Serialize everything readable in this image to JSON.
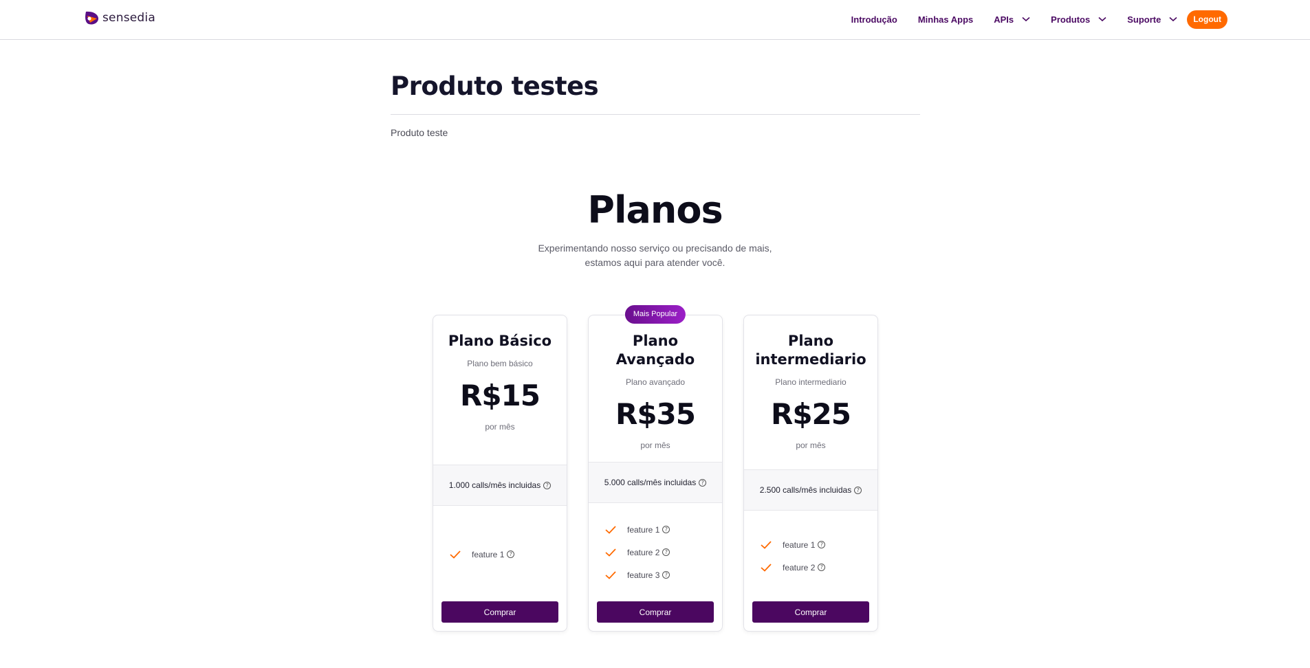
{
  "brand": {
    "name": "sensedia",
    "accent": "#ff6a00",
    "primary": "#4b0760"
  },
  "nav": {
    "items": [
      {
        "label": "Introdução"
      },
      {
        "label": "Minhas Apps"
      },
      {
        "label": "APIs"
      },
      {
        "label": "Produtos"
      },
      {
        "label": "Suporte"
      }
    ],
    "logout_label": "Logout"
  },
  "product": {
    "title": "Produto testes",
    "description": "Produto teste"
  },
  "plans_section": {
    "title": "Planos",
    "subtitle_line1": "Experimentando nosso serviço ou precisando de mais,",
    "subtitle_line2": "estamos aqui para atender você."
  },
  "plans": [
    {
      "name": "Plano Básico",
      "description": "Plano bem básico",
      "price": "R$15",
      "period": "por mês",
      "calls": "1.000 calls/mês incluidas",
      "features": [
        "feature 1"
      ],
      "button_label": "Comprar"
    },
    {
      "badge": "Mais Popular",
      "name_line1": "Plano",
      "name_line2": "Avançado",
      "description": "Plano avançado",
      "price": "R$35",
      "period": "por mês",
      "calls": "5.000 calls/mês incluidas",
      "features": [
        "feature 1",
        "feature 2",
        "feature 3"
      ],
      "button_label": "Comprar"
    },
    {
      "name_line1": "Plano",
      "name_line2": "intermediario",
      "description": "Plano intermediario",
      "price": "R$25",
      "period": "por mês",
      "calls": "2.500 calls/mês incluidas",
      "features": [
        "feature 1",
        "feature 2"
      ],
      "button_label": "Comprar"
    }
  ],
  "icons": {
    "help": "?"
  }
}
